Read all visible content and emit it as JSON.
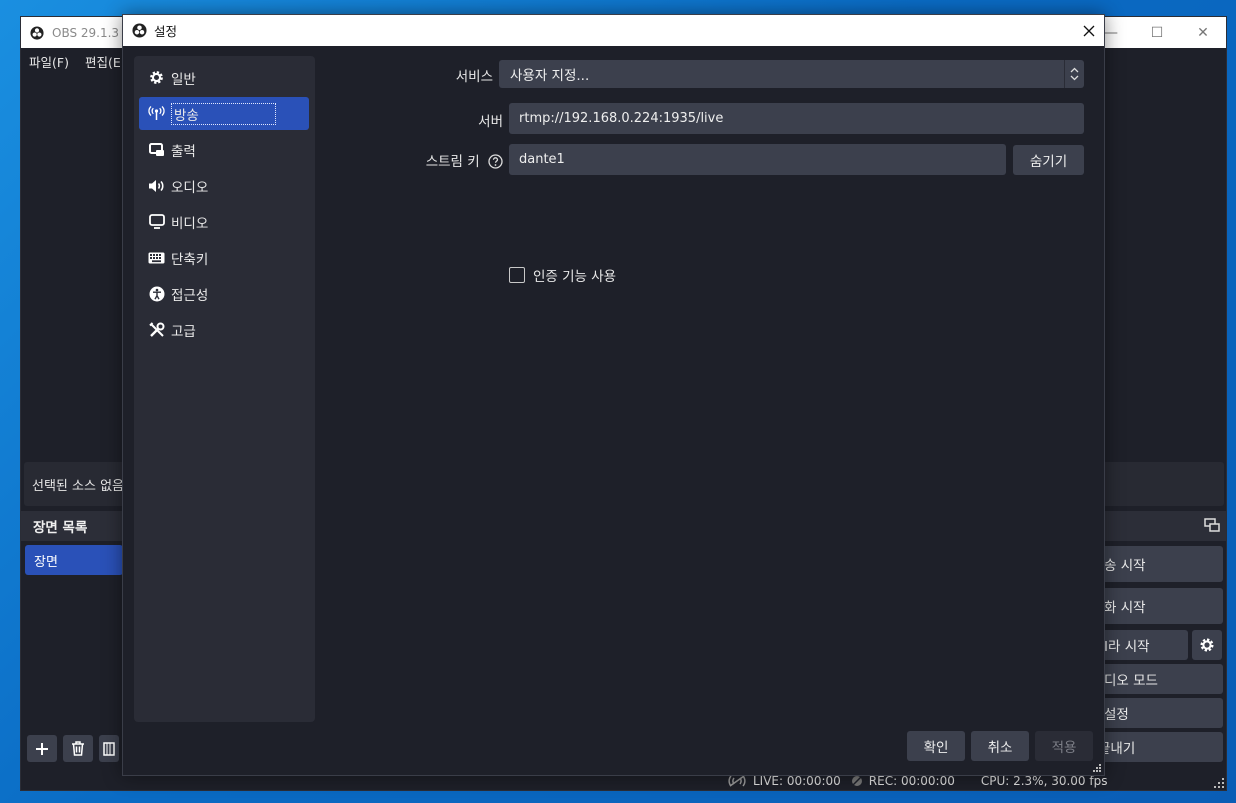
{
  "main_window": {
    "title": "OBS 29.1.3 -",
    "menu": [
      "파일(F)",
      "편집(E"
    ],
    "source_bar_text": "선택된 소스 없음",
    "scenes_header": "장면 목록",
    "scene_items": [
      "장면"
    ],
    "controls": {
      "stream": "송 시작",
      "record": "화 시작",
      "virtual_camera": "I라 시작",
      "studio_mode": "디오 모드",
      "settings": "설정",
      "exit": "끝내기"
    },
    "status": {
      "live": "LIVE: 00:00:00",
      "rec": "REC: 00:00:00",
      "cpu": "CPU: 2.3%, 30.00 fps"
    }
  },
  "dialog": {
    "title": "설정",
    "nav": [
      {
        "label": "일반",
        "icon": "gear-icon"
      },
      {
        "label": "방송",
        "icon": "antenna-icon",
        "active": true
      },
      {
        "label": "출력",
        "icon": "output-icon"
      },
      {
        "label": "오디오",
        "icon": "speaker-icon"
      },
      {
        "label": "비디오",
        "icon": "monitor-icon"
      },
      {
        "label": "단축키",
        "icon": "keyboard-icon"
      },
      {
        "label": "접근성",
        "icon": "accessibility-icon"
      },
      {
        "label": "고급",
        "icon": "tools-icon"
      }
    ],
    "service_label": "서비스",
    "service_value": "사용자 지정...",
    "server_label": "서버",
    "server_value": "rtmp://192.168.0.224:1935/live",
    "stream_key_label": "스트림 키",
    "stream_key_value": "dante1",
    "hide_button": "숨기기",
    "auth_checkbox_label": "인증 기능 사용",
    "auth_checked": false,
    "ok_button": "확인",
    "cancel_button": "취소",
    "apply_button": "적용"
  },
  "colors": {
    "background": "#1e2029",
    "panel": "#2a2c36",
    "control": "#3c404d",
    "accent": "#2a51b8"
  }
}
